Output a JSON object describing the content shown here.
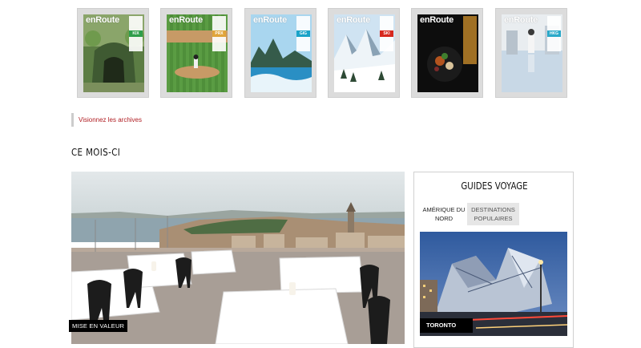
{
  "covers": [
    {
      "logo": "enRoute",
      "code": "KIX",
      "color": "#2f9e4a"
    },
    {
      "logo": "enRoute",
      "code": "PRX",
      "color": "#e0a43a"
    },
    {
      "logo": "enRoute",
      "code": "GIG",
      "color": "#1aa3c8"
    },
    {
      "logo": "enRoute",
      "code": "SKI",
      "color": "#d7281e"
    },
    {
      "logo": "enRoute",
      "code": "",
      "color": "#c58a2b"
    },
    {
      "logo": "enRoute",
      "code": "HKG",
      "color": "#2aa9c9"
    }
  ],
  "archives_link": "Visionnez les archives",
  "section_title": "CE MOIS-CI",
  "hero": {
    "badge": "MISE EN VALEUR"
  },
  "guides": {
    "title": "GUIDES VOYAGE",
    "tabs": [
      {
        "line1": "AMÉRIQUE DU",
        "line2": "NORD"
      },
      {
        "line1": "DESTINATIONS",
        "line2": "POPULAIRES"
      }
    ],
    "featured_city": "TORONTO"
  },
  "colors": {
    "accent_red": "#b01e23",
    "badge_bg": "#000000"
  }
}
